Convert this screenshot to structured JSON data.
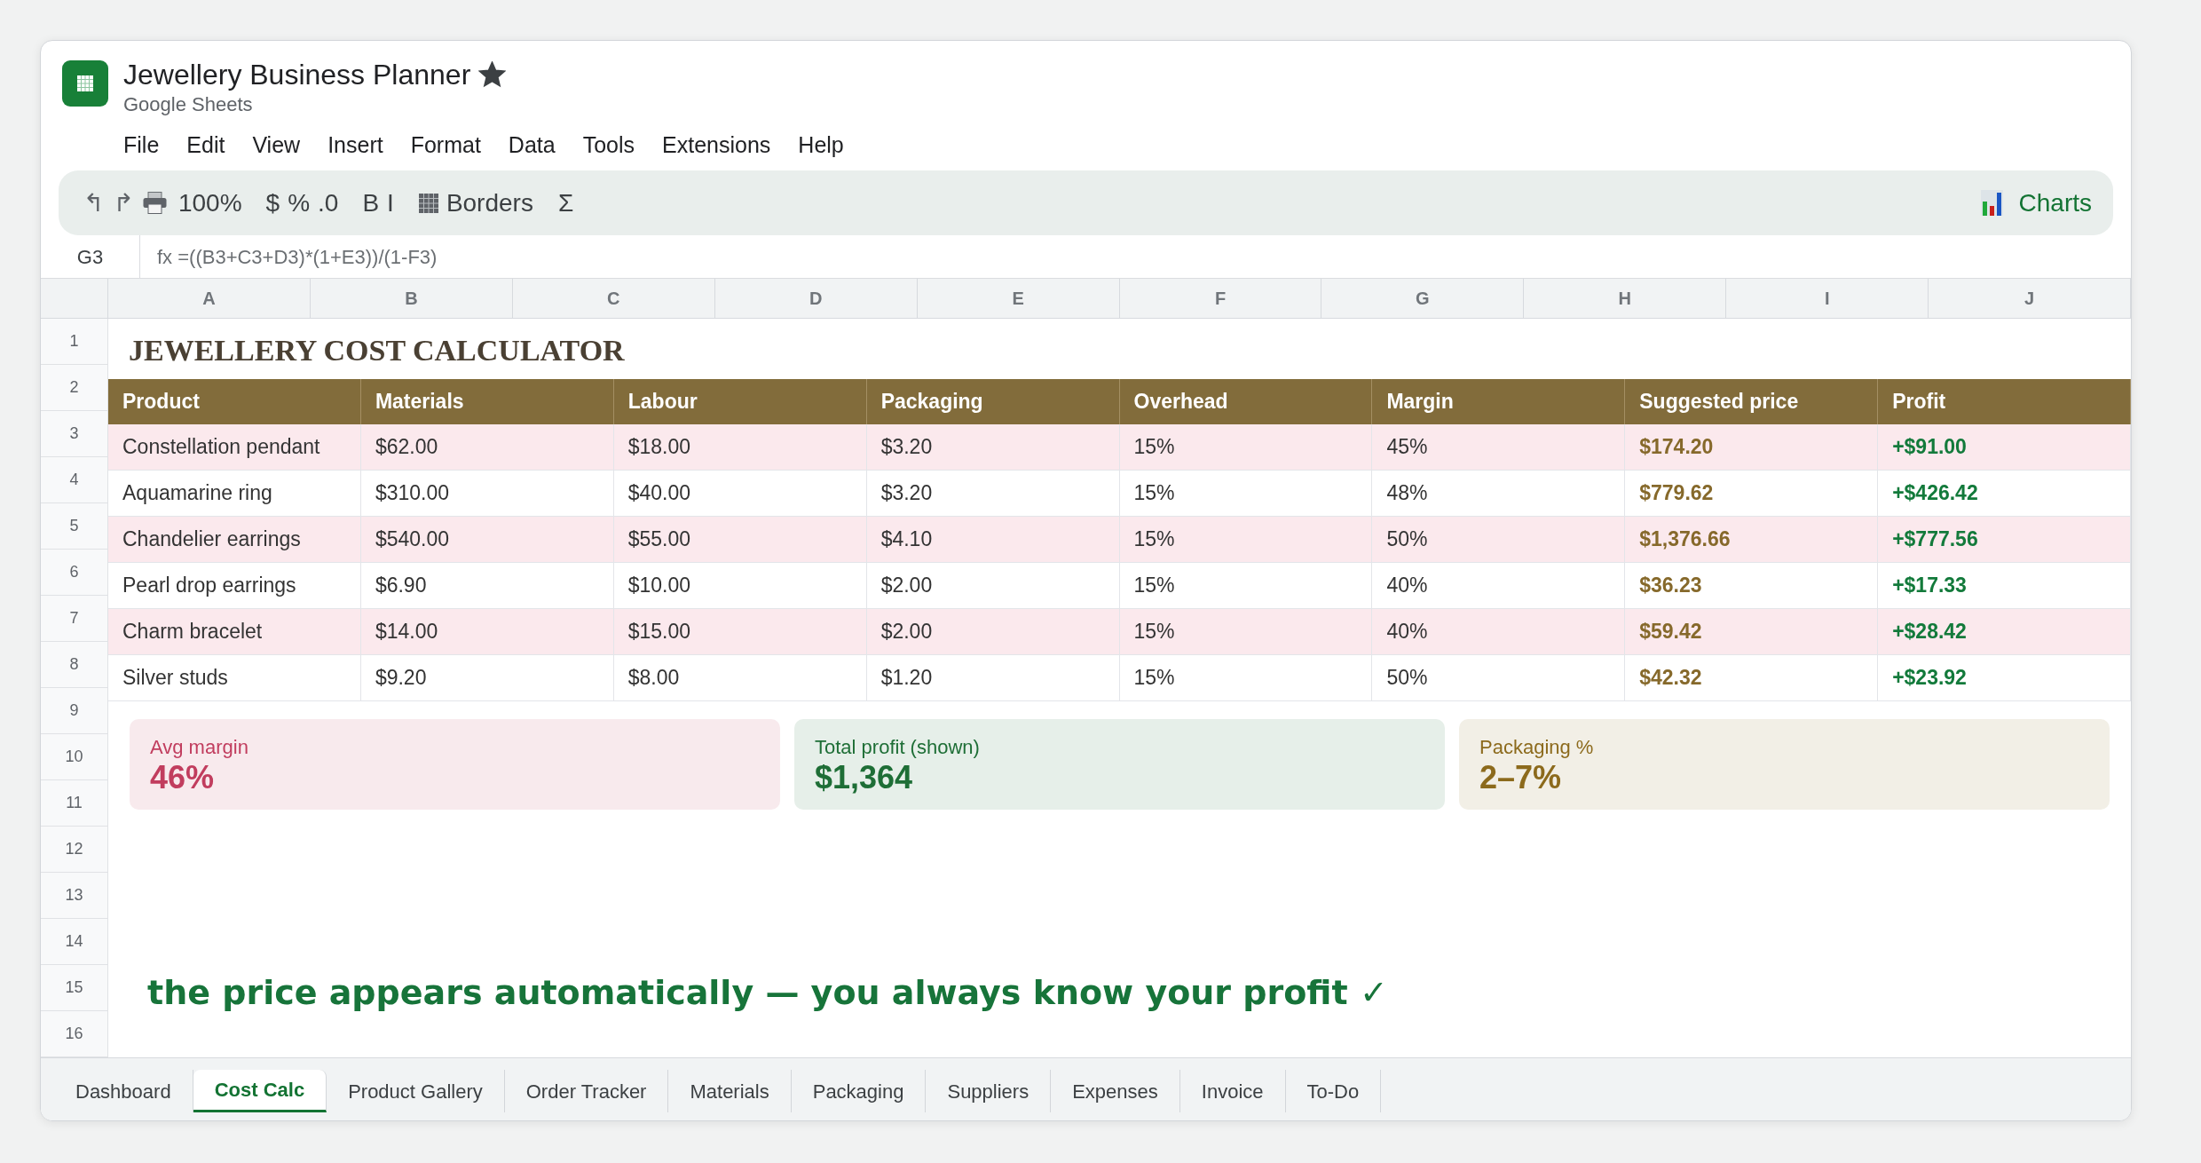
{
  "window": {
    "title": "Jewellery Business Planner",
    "starred": true,
    "app_name": "Google Sheets"
  },
  "menu": [
    "File",
    "Edit",
    "View",
    "Insert",
    "Format",
    "Data",
    "Tools",
    "Extensions",
    "Help"
  ],
  "toolbar": {
    "undo": "↰",
    "redo": "↱",
    "zoom": "100%",
    "number_formats": [
      "$",
      "%",
      ".0"
    ],
    "text_styles": [
      "B",
      "I"
    ],
    "borders": "Borders",
    "functions": "Σ",
    "charts": "Charts"
  },
  "formula_bar": {
    "cell_ref": "G3",
    "formula": "fx =((B3+C3+D3)*(1+E3))/(1-F3)"
  },
  "column_headers": [
    "A",
    "B",
    "C",
    "D",
    "E",
    "F",
    "G",
    "H",
    "I",
    "J"
  ],
  "row_numbers": [
    "1",
    "2",
    "3",
    "4",
    "5",
    "6",
    "7",
    "8",
    "9",
    "10",
    "11",
    "12",
    "13",
    "14",
    "15",
    "16"
  ],
  "sheet": {
    "title": "JEWELLERY COST CALCULATOR",
    "table": {
      "columns": [
        {
          "label": "Product",
          "kind": "text"
        },
        {
          "label": "Materials",
          "kind": "text"
        },
        {
          "label": "Labour",
          "kind": "text"
        },
        {
          "label": "Packaging",
          "kind": "text"
        },
        {
          "label": "Overhead",
          "kind": "text"
        },
        {
          "label": "Margin",
          "kind": "text"
        },
        {
          "label": "Suggested price",
          "kind": "price"
        },
        {
          "label": "Profit",
          "kind": "profit"
        }
      ],
      "rows": [
        [
          "Constellation pendant",
          "$62.00",
          "$18.00",
          "$3.20",
          "15%",
          "45%",
          "$174.20",
          "+$91.00"
        ],
        [
          "Aquamarine ring",
          "$310.00",
          "$40.00",
          "$3.20",
          "15%",
          "48%",
          "$779.62",
          "+$426.42"
        ],
        [
          "Chandelier earrings",
          "$540.00",
          "$55.00",
          "$4.10",
          "15%",
          "50%",
          "$1,376.66",
          "+$777.56"
        ],
        [
          "Pearl drop earrings",
          "$6.90",
          "$10.00",
          "$2.00",
          "15%",
          "40%",
          "$36.23",
          "+$17.33"
        ],
        [
          "Charm bracelet",
          "$14.00",
          "$15.00",
          "$2.00",
          "15%",
          "40%",
          "$59.42",
          "+$28.42"
        ],
        [
          "Silver studs",
          "$9.20",
          "$8.00",
          "$1.20",
          "15%",
          "50%",
          "$42.32",
          "+$23.92"
        ]
      ]
    },
    "summary_cards": [
      {
        "label": "Avg margin",
        "value": "46%",
        "color": "#c13d5e"
      },
      {
        "label": "Total profit (shown)",
        "value": "$1,364",
        "color": "#1e6e36"
      },
      {
        "label": "Packaging %",
        "value": "2–7%",
        "color": "#8c6a1c"
      }
    ],
    "annotation": "the price appears automatically — you always know your profit ✓"
  },
  "sheet_tabs": [
    {
      "label": "Dashboard",
      "selected": false
    },
    {
      "label": "Cost Calc",
      "selected": true
    },
    {
      "label": "Product Gallery",
      "selected": false
    },
    {
      "label": "Order Tracker",
      "selected": false
    },
    {
      "label": "Materials",
      "selected": false
    },
    {
      "label": "Packaging",
      "selected": false
    },
    {
      "label": "Suppliers",
      "selected": false
    },
    {
      "label": "Expenses",
      "selected": false
    },
    {
      "label": "Invoice",
      "selected": false
    },
    {
      "label": "To-Do",
      "selected": false
    }
  ]
}
